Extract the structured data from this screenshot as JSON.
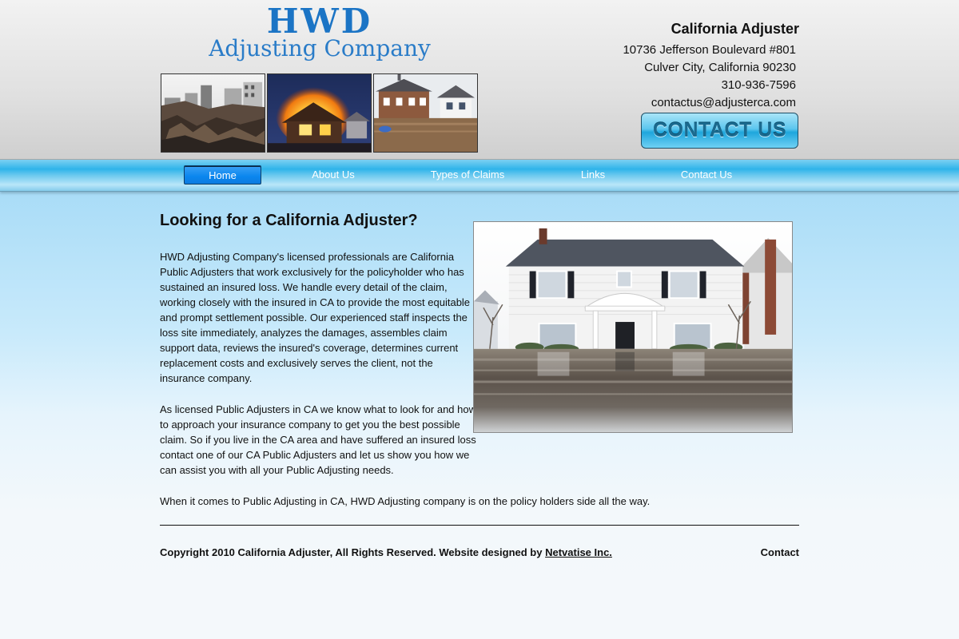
{
  "header": {
    "logo_line1": "HWD",
    "logo_line2": "Adjusting Company",
    "contact_title": "California Adjuster",
    "address_line1": "10736 Jefferson Boulevard #801",
    "address_line2": "Culver City, California 90230",
    "phone": "310-936-7596",
    "email": "contactus@adjusterca.com",
    "contact_button": "CONTACT US",
    "thumbnails": [
      "earthquake-damage-photo",
      "house-fire-photo",
      "flooded-street-photo"
    ]
  },
  "nav": {
    "items": [
      {
        "label": "Home",
        "active": true
      },
      {
        "label": "About Us",
        "active": false
      },
      {
        "label": "Types of Claims",
        "active": false
      },
      {
        "label": "Links",
        "active": false
      },
      {
        "label": "Contact Us",
        "active": false
      }
    ]
  },
  "main": {
    "title": "Looking for a California Adjuster?",
    "paragraph1": "HWD Adjusting Company's licensed professionals are California Public Adjusters that work exclusively for the policyholder who has sustained an insured loss. We handle every detail of the claim, working closely with the insured in CA to provide the most equitable and prompt settlement possible. Our experienced staff inspects the loss site immediately, analyzes the damages, assembles claim support data, reviews the insured's coverage, determines current replacement costs and exclusively serves the client, not the insurance company.",
    "paragraph2": "As licensed Public Adjusters in CA we know what to look for and how to approach your insurance company to get you the best possible claim. So if you live in the CA area and have suffered an insured loss contact one of our CA Public Adjusters and let us show you how we can assist you with all your Public Adjusting needs.",
    "paragraph3": "When it comes to Public Adjusting in CA, HWD Adjusting company is on the policy holders side all the way.",
    "hero_image": "flooded-house-photo"
  },
  "footer": {
    "copyright": "Copyright 2010 California Adjuster, All Rights Reserved. Website designed by ",
    "designer_link": "Netvatise Inc.",
    "contact_link": "Contact"
  },
  "colors": {
    "logo_blue": "#1b74c5",
    "nav_active": "#0a86ee",
    "nav_bar": "#2fb4ea"
  }
}
